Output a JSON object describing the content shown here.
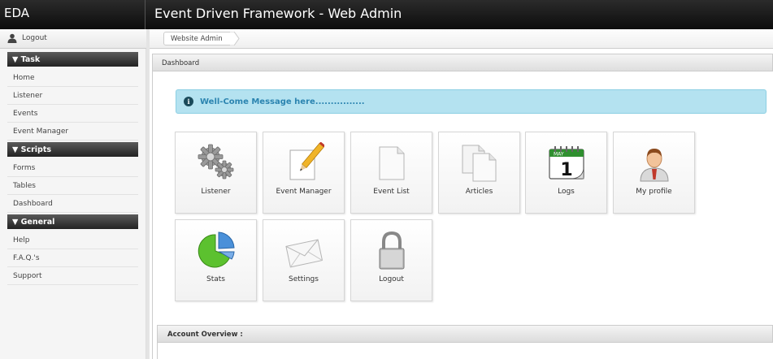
{
  "header": {
    "brand": "EDA",
    "title": "Event Driven Framework - Web Admin"
  },
  "sidebar": {
    "logout_label": "Logout",
    "sections": [
      {
        "title": "▼ Task",
        "items": [
          "Home",
          "Listener",
          "Events",
          "Event Manager"
        ]
      },
      {
        "title": "▼ Scripts",
        "items": [
          "Forms",
          "Tables",
          "Dashboard"
        ]
      },
      {
        "title": "▼ General",
        "items": [
          "Help",
          "F.A.Q.'s",
          "Support"
        ]
      }
    ]
  },
  "breadcrumb": {
    "item": "Website Admin"
  },
  "panel": {
    "title": "Dashboard"
  },
  "alert": {
    "icon": "info-icon",
    "message": "Well-Come Message here................"
  },
  "tiles": [
    {
      "label": "Listener",
      "icon": "gears-icon"
    },
    {
      "label": "Event Manager",
      "icon": "pencil-document-icon"
    },
    {
      "label": "Event List",
      "icon": "blank-document-icon"
    },
    {
      "label": "Articles",
      "icon": "documents-icon"
    },
    {
      "label": "Logs",
      "icon": "calendar-icon"
    },
    {
      "label": "My profile",
      "icon": "user-profile-icon"
    },
    {
      "label": "Stats",
      "icon": "pie-chart-icon"
    },
    {
      "label": "Settings",
      "icon": "envelope-icon"
    },
    {
      "label": "Logout",
      "icon": "padlock-icon"
    }
  ],
  "calendar": {
    "month": "MAY",
    "day": "1"
  },
  "account": {
    "title": "Account Overview :"
  },
  "colors": {
    "alert_bg": "#b4e2f0",
    "alert_text": "#2b84b0",
    "topbar": "#111111"
  }
}
